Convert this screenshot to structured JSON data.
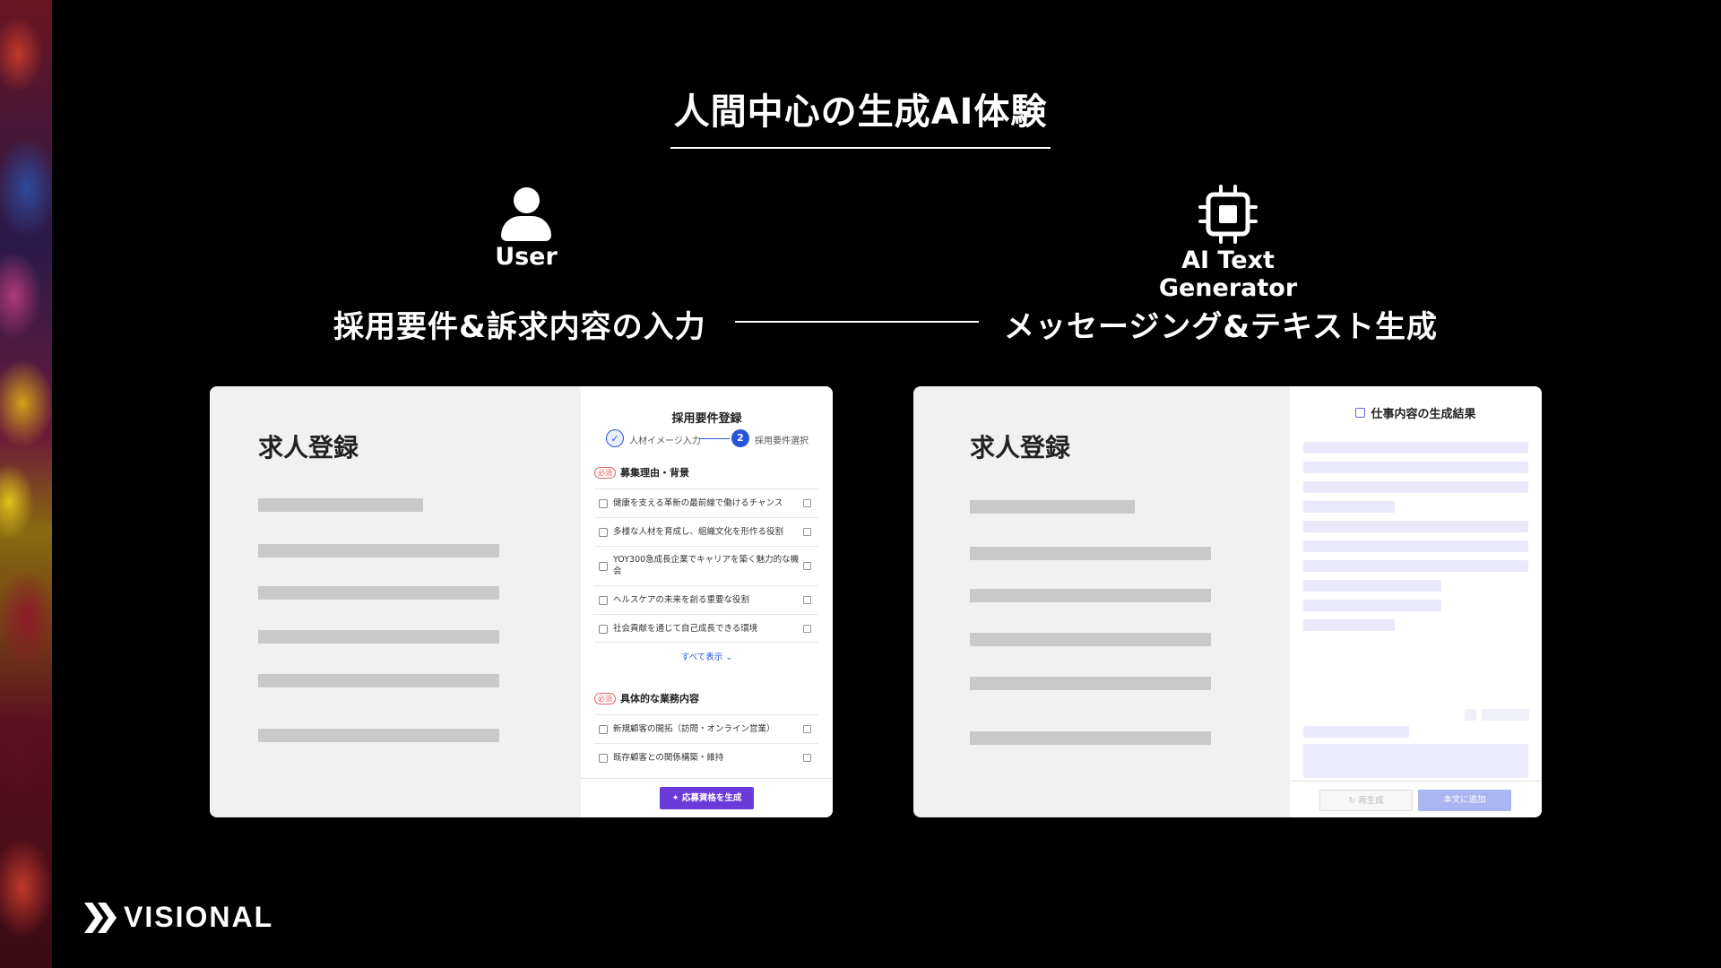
{
  "slide": {
    "title": "人間中心の生成AI体験",
    "user_label": "User",
    "ai_label": "AI Text Generator",
    "left_stage": "採用要件&訴求内容の入力",
    "right_stage": "メッセージング&テキスト生成"
  },
  "left_card": {
    "page_title": "求人登録",
    "panel": {
      "title": "採用要件登録",
      "steps": [
        {
          "number": "✓",
          "label": "人材イメージ入力"
        },
        {
          "number": "2",
          "label": "採用要件選択"
        }
      ],
      "sections": [
        {
          "badge": "必須",
          "heading": "募集理由・背景",
          "items": [
            "健康を支える革新の最前線で働けるチャンス",
            "多様な人材を育成し、組織文化を形作る役割",
            "YOY300急成長企業でキャリアを築く魅力的な機会",
            "ヘルスケアの未来を創る重要な役割",
            "社会貢献を通じて自己成長できる環境"
          ],
          "show_all": "すべて表示 ⌄"
        },
        {
          "badge": "必須",
          "heading": "具体的な業務内容",
          "items": [
            "新規顧客の開拓（訪問・オンライン営業）",
            "既存顧客との関係構築・維持"
          ]
        }
      ],
      "generate_button": "✦ 応募資格を生成"
    }
  },
  "right_card": {
    "page_title": "求人登録",
    "panel": {
      "title": "仕事内容の生成結果",
      "regenerate_button": "↻ 再生成",
      "add_button": "本文に追加"
    }
  },
  "brand": {
    "logo_text": "VISIONAL"
  },
  "colors": {
    "background": "#000000",
    "accent_blue": "#2a55d8",
    "generate_purple": "#6a3bd8",
    "required_red": "#e06363",
    "placeholder_gray": "#c9c9c9",
    "placeholder_lavender": "#e9e9fb"
  }
}
